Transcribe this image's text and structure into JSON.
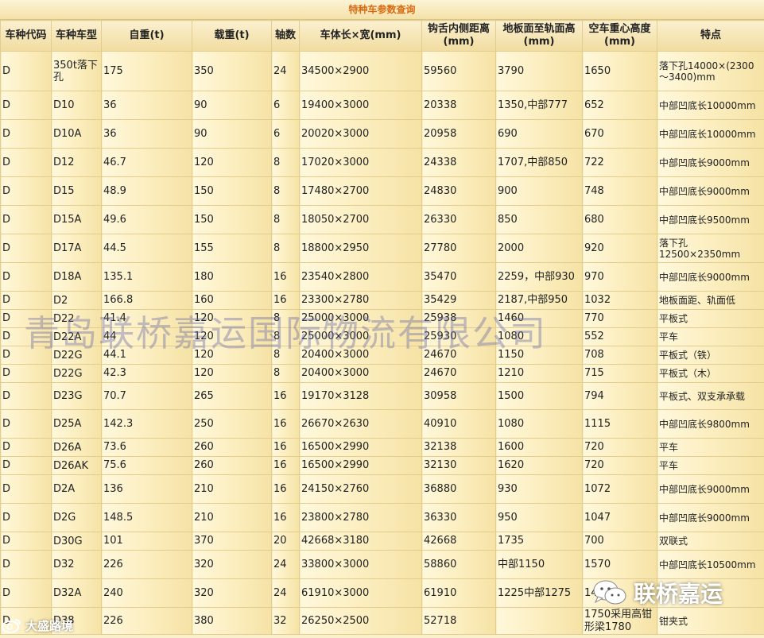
{
  "title": "特种车参数查询",
  "columns": [
    "车种代码",
    "车种车型",
    "自重(t)",
    "载重(t)",
    "轴数",
    "车体长×宽(mm)",
    "钩舌内侧距离(mm)",
    "地板面至轨面高(mm)",
    "空车重心高度(mm)",
    "特点"
  ],
  "rows": [
    [
      "D",
      "350t落下孔",
      "175",
      "350",
      "24",
      "34500×2900",
      "59560",
      "3790",
      "1650",
      "落下孔14000×(2300～3400)mm"
    ],
    [
      "D",
      "D10",
      "36",
      "90",
      "6",
      "19400×3000",
      "20338",
      "1350,中部777",
      "652",
      "中部凹底长10000mm"
    ],
    [
      "D",
      "D10A",
      "36",
      "90",
      "6",
      "20020×3000",
      "20958",
      "690",
      "670",
      "中部凹底长10000mm"
    ],
    [
      "D",
      "D12",
      "46.7",
      "120",
      "8",
      "17020×3000",
      "24338",
      "1707,中部850",
      "722",
      "中部凹底长9000mm"
    ],
    [
      "D",
      "D15",
      "48.9",
      "150",
      "8",
      "17480×2700",
      "24830",
      "900",
      "748",
      "中部凹底长9000mm"
    ],
    [
      "D",
      "D15A",
      "49.6",
      "150",
      "8",
      "18050×2700",
      "26330",
      "850",
      "680",
      "中部凹底长9500mm"
    ],
    [
      "D",
      "D17A",
      "44.5",
      "155",
      "8",
      "18800×2950",
      "27780",
      "2000",
      "920",
      "落下孔12500×2350mm"
    ],
    [
      "D",
      "D18A",
      "135.1",
      "180",
      "16",
      "23540×2800",
      "35470",
      "2259，中部930",
      "970",
      "中部凹底长9000mm"
    ],
    [
      "D",
      "D2",
      "166.8",
      "160",
      "16",
      "23300×2780",
      "35429",
      "2187,中部950",
      "1032",
      "地板面距、轨面低"
    ],
    [
      "D",
      "D22",
      "41.4",
      "120",
      "8",
      "25000×3000",
      "25938",
      "1460",
      "770",
      "平板式"
    ],
    [
      "D",
      "D22A",
      "44",
      "120",
      "8",
      "25000×3000",
      "25930",
      "1080",
      "552",
      "平车"
    ],
    [
      "D",
      "D22G",
      "44.1",
      "120",
      "8",
      "20400×3000",
      "24670",
      "1150",
      "708",
      "平板式（铁）"
    ],
    [
      "D",
      "D22G",
      "42.3",
      "120",
      "8",
      "20400×3000",
      "24670",
      "1210",
      "715",
      "平板式（木）"
    ],
    [
      "D",
      "D23G",
      "70.7",
      "265",
      "16",
      "19170×3128",
      "30958",
      "1500",
      "794",
      "平板式、双支承承载"
    ],
    [
      "D",
      "D25A",
      "142.3",
      "250",
      "16",
      "26670×2630",
      "40910",
      "1080",
      "1115",
      "中部凹底长9800mm"
    ],
    [
      "D",
      "D26A",
      "73.6",
      "260",
      "16",
      "16500×2990",
      "32138",
      "1600",
      "720",
      "平车"
    ],
    [
      "D",
      "D26AK",
      "75.6",
      "260",
      "16",
      "16500×2990",
      "32130",
      "1620",
      "720",
      "平车"
    ],
    [
      "D",
      "D2A",
      "136",
      "210",
      "16",
      "24150×2760",
      "36880",
      "930",
      "1072",
      "中部凹底长9000mm"
    ],
    [
      "D",
      "D2G",
      "148.5",
      "210",
      "16",
      "23800×2780",
      "36330",
      "950",
      "1047",
      "中部凹底长9000mm"
    ],
    [
      "D",
      "D30G",
      "101",
      "370",
      "20",
      "42668×3180",
      "42668",
      "1735",
      "700",
      "双联式"
    ],
    [
      "D",
      "D32",
      "226",
      "320",
      "24",
      "33800×3000",
      "58860",
      "中部1150",
      "1570",
      "中部凹底长10500mm"
    ],
    [
      "D",
      "D32A",
      "240",
      "320",
      "24",
      "61910×3000",
      "61910",
      "1225中部1275",
      "14",
      ""
    ],
    [
      "D",
      "D38",
      "226",
      "380",
      "32",
      "26250×2500",
      "52718",
      "",
      "1750采用高钳形梁1780",
      "钳夹式"
    ]
  ],
  "watermark_text": "青岛联桥嘉运国际物流有限公司",
  "wechat_brand": "联桥嘉运",
  "weibo_brand": "大盛路境"
}
